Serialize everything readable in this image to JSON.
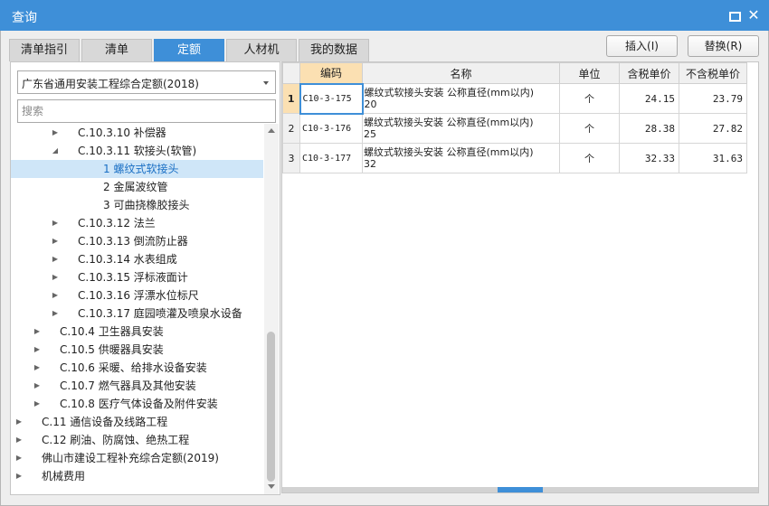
{
  "window": {
    "title": "查询"
  },
  "tabs": [
    {
      "label": "清单指引",
      "active": false
    },
    {
      "label": "清单",
      "active": false
    },
    {
      "label": "定额",
      "active": true
    },
    {
      "label": "人材机",
      "active": false
    },
    {
      "label": "我的数据",
      "active": false
    }
  ],
  "actions": {
    "insert_label": "插入(I)",
    "replace_label": "替换(R)"
  },
  "library": {
    "selected": "广东省通用安装工程综合定额(2018)"
  },
  "search": {
    "placeholder": "搜索",
    "value": ""
  },
  "tree": [
    {
      "label": "C.10.3.10 补偿器",
      "level": 2,
      "expander": "collapsed"
    },
    {
      "label": "C.10.3.11 软接头(软管)",
      "level": 2,
      "expander": "expanded"
    },
    {
      "label": "1 螺纹式软接头",
      "level": 3,
      "expander": "none",
      "selected": true
    },
    {
      "label": "2 金属波纹管",
      "level": 3,
      "expander": "none"
    },
    {
      "label": "3 可曲挠橡胶接头",
      "level": 3,
      "expander": "none"
    },
    {
      "label": "C.10.3.12 法兰",
      "level": 2,
      "expander": "collapsed"
    },
    {
      "label": "C.10.3.13 倒流防止器",
      "level": 2,
      "expander": "collapsed"
    },
    {
      "label": "C.10.3.14 水表组成",
      "level": 2,
      "expander": "collapsed"
    },
    {
      "label": "C.10.3.15 浮标液面计",
      "level": 2,
      "expander": "collapsed"
    },
    {
      "label": "C.10.3.16 浮漂水位标尺",
      "level": 2,
      "expander": "collapsed"
    },
    {
      "label": "C.10.3.17 庭园喷灌及喷泉水设备",
      "level": 2,
      "expander": "collapsed"
    },
    {
      "label": "C.10.4 卫生器具安装",
      "level": 1,
      "expander": "collapsed"
    },
    {
      "label": "C.10.5 供暖器具安装",
      "level": 1,
      "expander": "collapsed"
    },
    {
      "label": "C.10.6 采暖、给排水设备安装",
      "level": 1,
      "expander": "collapsed"
    },
    {
      "label": "C.10.7 燃气器具及其他安装",
      "level": 1,
      "expander": "collapsed"
    },
    {
      "label": "C.10.8 医疗气体设备及附件安装",
      "level": 1,
      "expander": "collapsed"
    },
    {
      "label": "C.11 通信设备及线路工程",
      "level": 0,
      "expander": "collapsed"
    },
    {
      "label": "C.12 刷油、防腐蚀、绝热工程",
      "level": 0,
      "expander": "collapsed"
    },
    {
      "label": "佛山市建设工程补充综合定额(2019)",
      "level": 0,
      "expander": "collapsed"
    },
    {
      "label": "机械费用",
      "level": 0,
      "expander": "collapsed"
    }
  ],
  "grid": {
    "columns": [
      "编码",
      "名称",
      "单位",
      "含税单价",
      "不含税单价"
    ],
    "rows": [
      {
        "num": "1",
        "code": "C10-3-175",
        "name_line1": "螺纹式软接头安装 公称直径(mm以内)",
        "name_line2": "20",
        "unit": "个",
        "price_tax": "24.15",
        "price_notax": "23.79",
        "current": true
      },
      {
        "num": "2",
        "code": "C10-3-176",
        "name_line1": "螺纹式软接头安装 公称直径(mm以内)",
        "name_line2": "25",
        "unit": "个",
        "price_tax": "28.38",
        "price_notax": "27.82",
        "current": false
      },
      {
        "num": "3",
        "code": "C10-3-177",
        "name_line1": "螺纹式软接头安装 公称直径(mm以内)",
        "name_line2": "32",
        "unit": "个",
        "price_tax": "32.33",
        "price_notax": "31.63",
        "current": false
      }
    ]
  },
  "colors": {
    "accent": "#3e8fd8",
    "selection": "#cfe6f8",
    "header_highlight": "#fbe0b2"
  },
  "icons": {
    "maximize": "maximize-icon",
    "close": "close-icon",
    "dropdown": "chevron-down-icon"
  }
}
